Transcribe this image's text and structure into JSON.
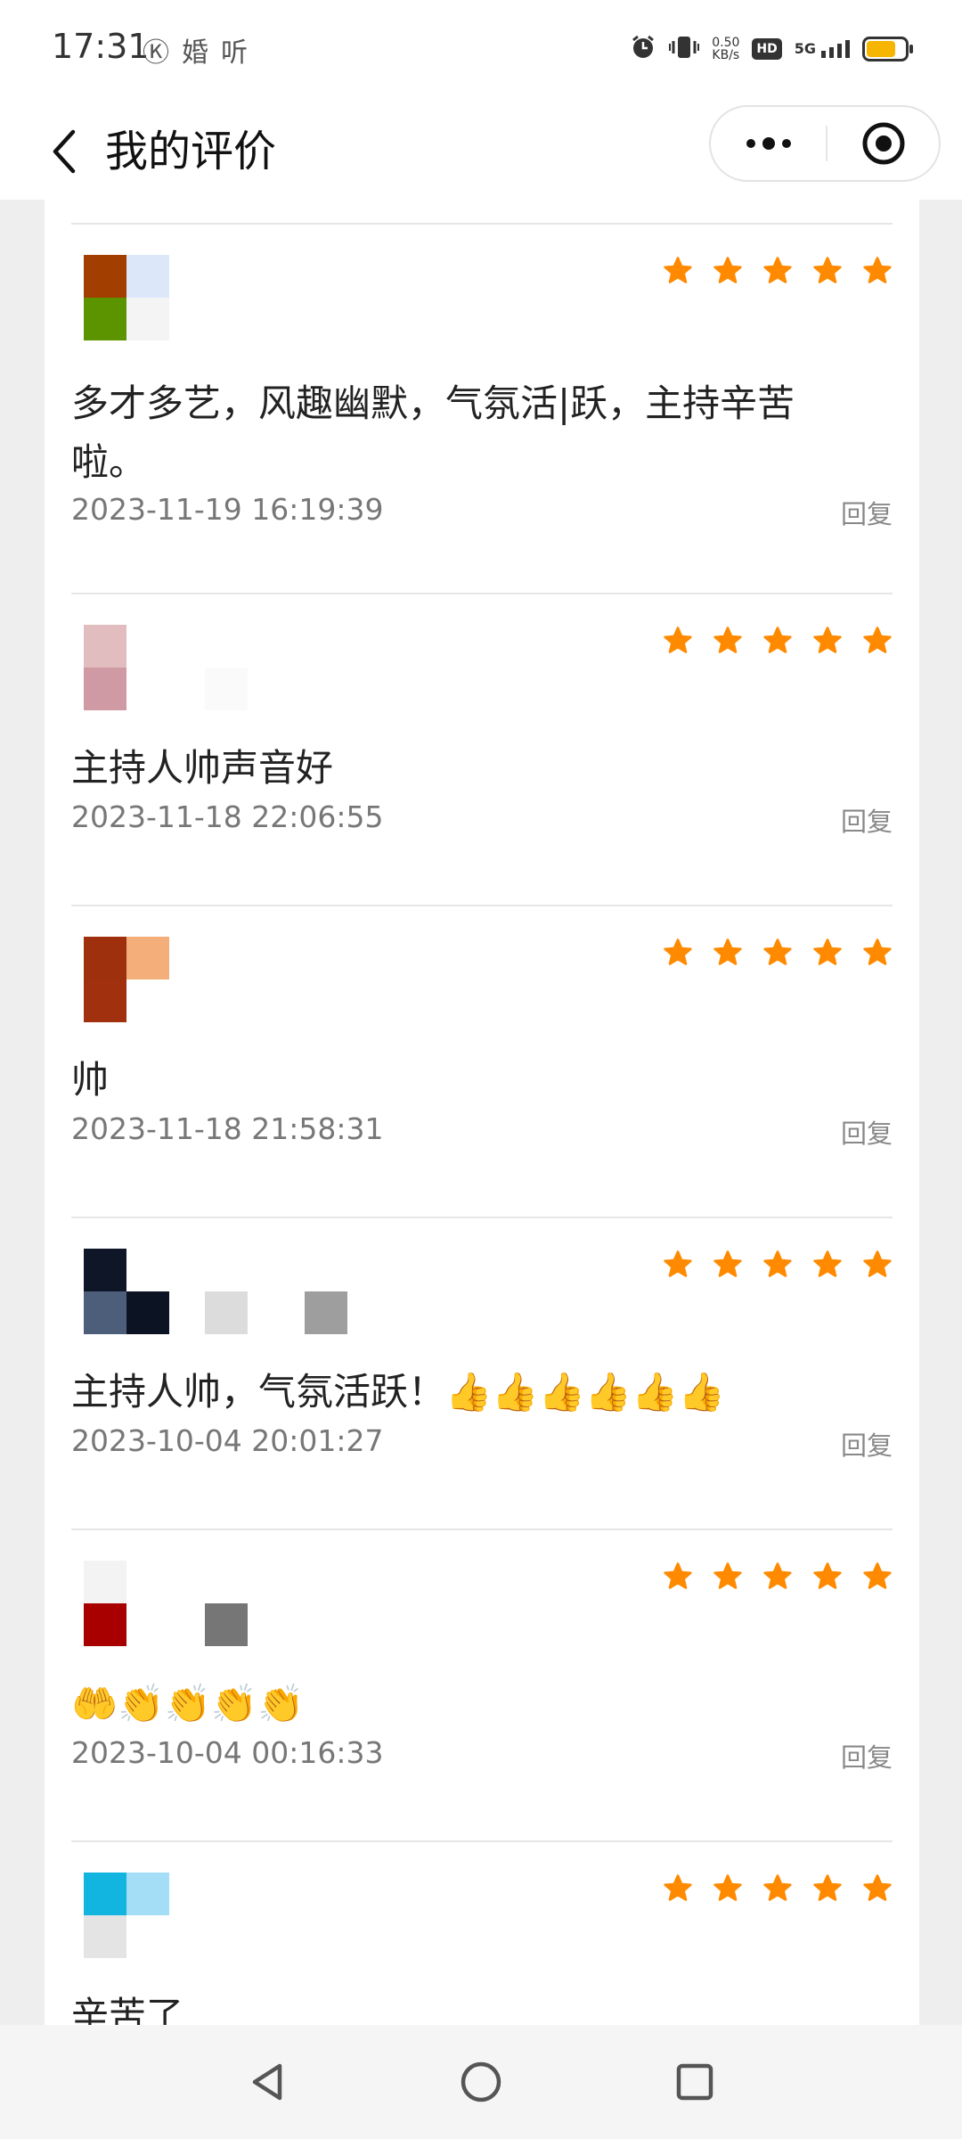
{
  "status_bar": {
    "time": "17:31",
    "left_icons": [
      "k-circle-icon",
      "marriage-icon",
      "listen-icon"
    ],
    "left_icon_glyphs": [
      "Ⓚ",
      "婚",
      "听"
    ],
    "net_speed_value": "0.50",
    "net_speed_unit": "KB/s",
    "hd_badge": "HD",
    "network": "5G",
    "battery_level": 0.75
  },
  "nav": {
    "title": "我的评价"
  },
  "colors": {
    "star": "#ff8a00",
    "divider": "#e6e6e6",
    "page_bg": "#eeeeee"
  },
  "reviews": [
    {
      "rating": 5,
      "text": "多才多艺，风趣幽默，气氛活|跃，主持辛苦啦。",
      "date": "2023-11-19 16:19:39",
      "reply_label": "回复",
      "avatar_colors": [
        "#a23f00",
        "#dde7fa",
        "#5c9400",
        "#f4f4f4"
      ],
      "name_colors": []
    },
    {
      "rating": 5,
      "text": "主持人帅声音好",
      "date": "2023-11-18 22:06:55",
      "reply_label": "回复",
      "avatar_colors": [
        "#e2bdbf",
        "#ffffff",
        "#cf9aa3",
        "#ffffff"
      ],
      "name_colors": [
        "#fafafa"
      ]
    },
    {
      "rating": 5,
      "text": "帅",
      "date": "2023-11-18 21:58:31",
      "reply_label": "回复",
      "avatar_colors": [
        "#9e300d",
        "#f4ae7a",
        "#a0300e",
        "#ffffff"
      ],
      "name_colors": []
    },
    {
      "rating": 5,
      "text": "主持人帅，气氛活跃！👍👍👍👍👍👍",
      "date": "2023-10-04 20:01:27",
      "reply_label": "回复",
      "avatar_colors": [
        "#0f1628",
        "#ffffff",
        "#4d5e7a",
        "#0c1424"
      ],
      "name_colors": [
        "#dcdcdc",
        "#ffffff",
        "#9e9e9e"
      ]
    },
    {
      "rating": 5,
      "text": "🤲👏👏👏👏",
      "date": "2023-10-04 00:16:33",
      "reply_label": "回复",
      "avatar_colors": [
        "#f3f3f3",
        "#ffffff",
        "#a80000",
        "#ffffff"
      ],
      "name_colors": [
        "#767676"
      ]
    },
    {
      "rating": 5,
      "text": "辛苦了",
      "date": "",
      "reply_label": "",
      "avatar_colors": [
        "#12b4e0",
        "#a4def6",
        "#e4e4e4",
        "#ffffff"
      ],
      "name_colors": []
    }
  ]
}
